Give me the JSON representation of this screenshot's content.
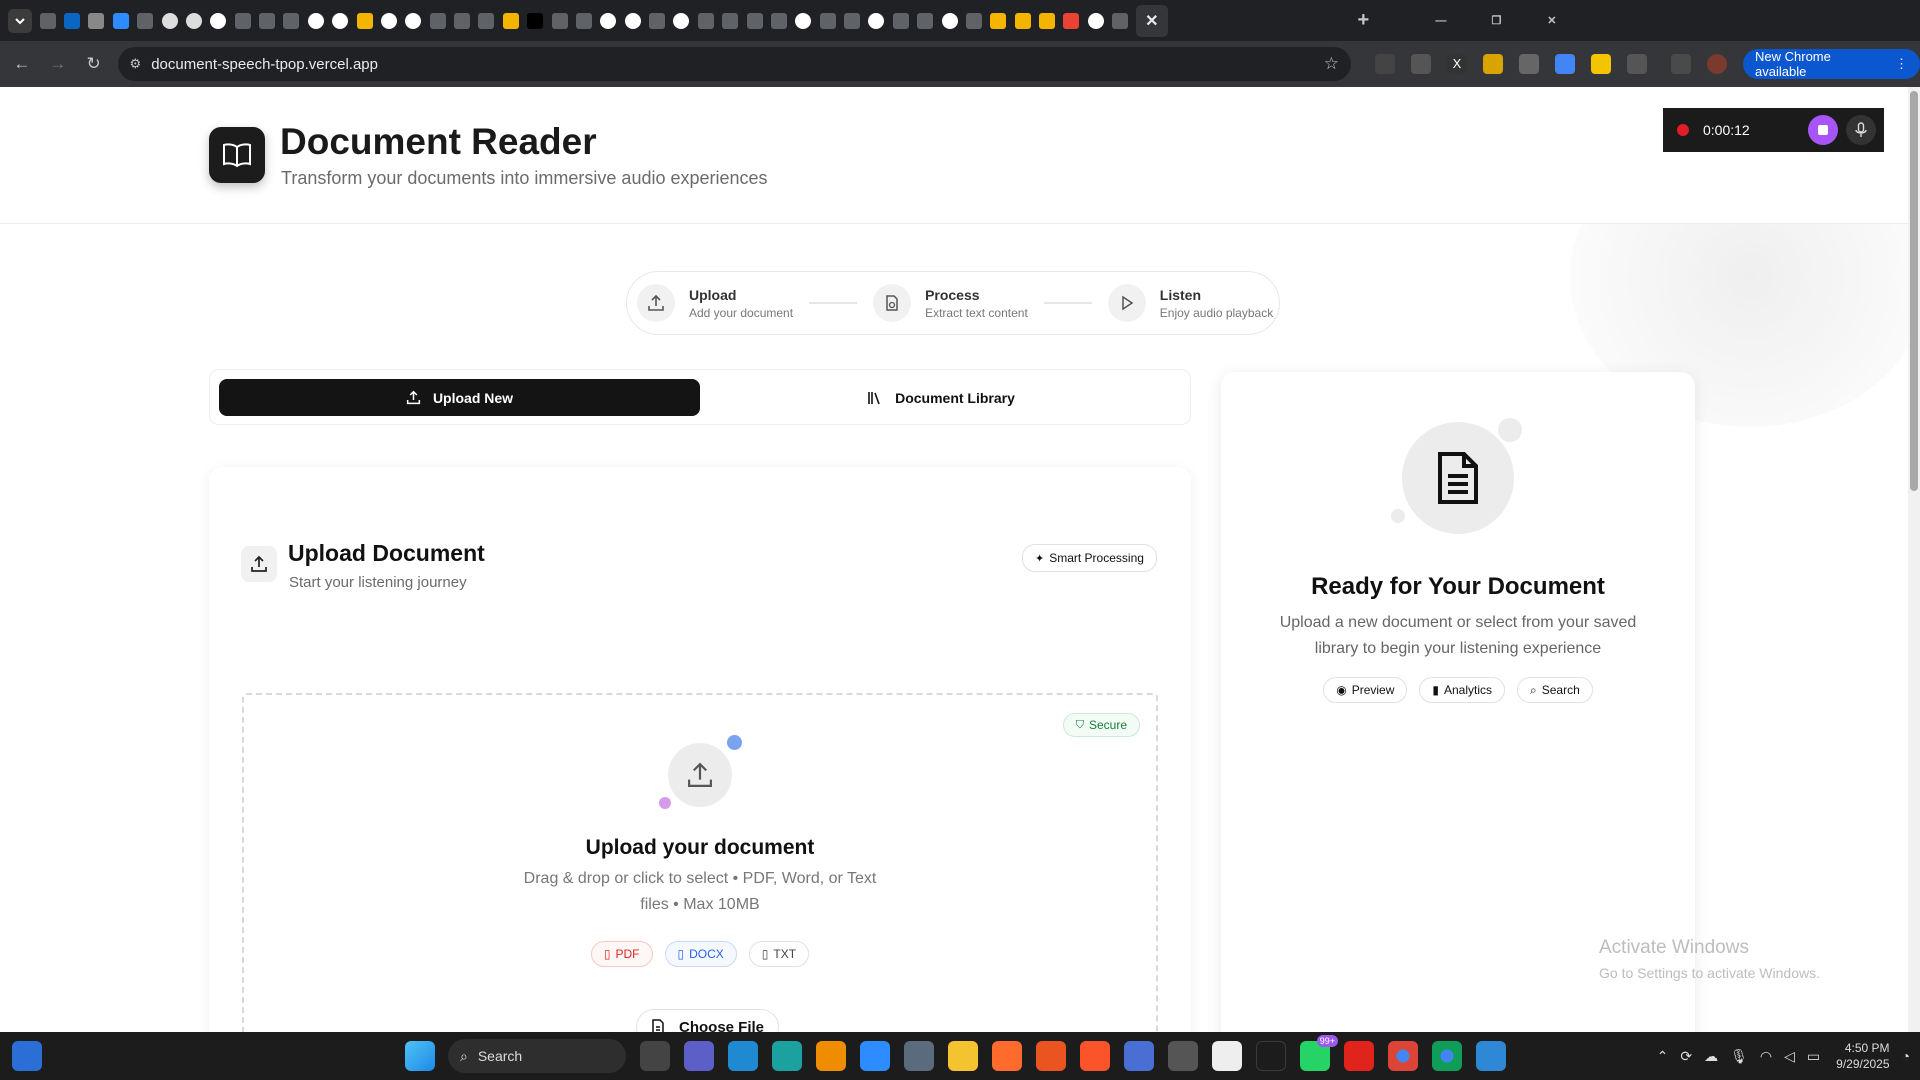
{
  "browser": {
    "tab_icons": [
      "app-icon",
      "linkedin-icon",
      "code-icon",
      "zoom-icon",
      "app-icon",
      "openai-icon",
      "openai-icon",
      "github-icon",
      "app-icon",
      "app-icon",
      "app-icon",
      "google-icon",
      "google-icon",
      "drive-icon",
      "google-icon",
      "google-icon",
      "app-icon",
      "app-icon",
      "app-icon",
      "drive-icon",
      "x-icon",
      "app-icon",
      "app-icon",
      "github-icon",
      "github-icon",
      "app-icon",
      "github-icon",
      "app-icon",
      "app-icon",
      "app-icon",
      "app-icon",
      "github-icon",
      "app-icon",
      "app-icon",
      "github-icon",
      "app-icon",
      "app-icon",
      "google-icon",
      "app-icon",
      "drive-icon",
      "drive-icon",
      "drive-icon",
      "gmail-icon",
      "github-icon",
      "app-icon"
    ],
    "url": "document-speech-tpop.vercel.app",
    "new_chrome": "New Chrome available"
  },
  "app": {
    "title": "Document Reader",
    "subtitle": "Transform your documents into immersive audio experiences"
  },
  "recorder": {
    "time": "0:00:12"
  },
  "steps": [
    {
      "label": "Upload",
      "sub": "Add your document",
      "icon": "upload-icon"
    },
    {
      "label": "Process",
      "sub": "Extract text content",
      "icon": "process-icon"
    },
    {
      "label": "Listen",
      "sub": "Enjoy audio playback",
      "icon": "play-icon"
    }
  ],
  "tabs": {
    "upload": "Upload New",
    "library": "Document Library"
  },
  "upload": {
    "title": "Upload Document",
    "subtitle": "Start your listening journey",
    "badge": "Smart Processing",
    "secure": "Secure",
    "drop_title": "Upload your document",
    "drop_line1": "Drag & drop or click to select • PDF, Word, or Text",
    "drop_line2": "files • Max 10MB",
    "formats": [
      "PDF",
      "DOCX",
      "TXT"
    ],
    "choose": "Choose File"
  },
  "side": {
    "title": "Ready for Your Document",
    "line1": "Upload a new document or select from your saved",
    "line2": "library to begin your listening experience",
    "chips": [
      "Preview",
      "Analytics",
      "Search"
    ]
  },
  "watermark": {
    "line1": "Activate Windows",
    "line2": "Go to Settings to activate Windows."
  },
  "taskbar": {
    "search": "Search",
    "time": "4:50 PM",
    "date": "9/29/2025",
    "badge": "99+"
  },
  "colors": {
    "accent": "#141414",
    "record": "#e11d2a",
    "stop": "#a855f7",
    "pdf": "#dc2626",
    "docx": "#2563eb",
    "secure": "#15803d"
  }
}
